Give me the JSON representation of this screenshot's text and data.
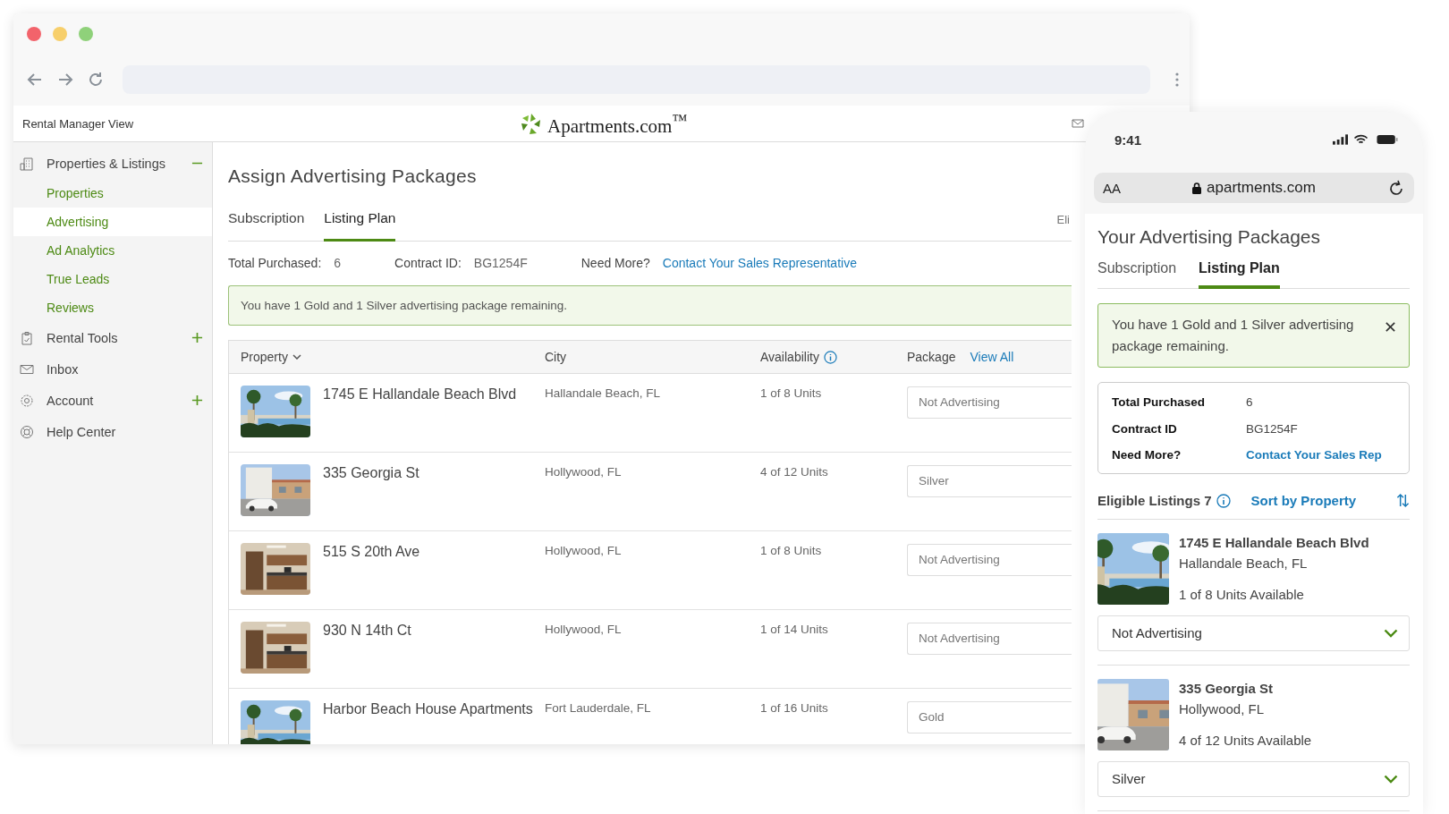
{
  "browser": {
    "header": {
      "title": "Rental Manager View",
      "logo": "Apartments.com$^{™}$"
    },
    "sidebar": {
      "items": [
        {
          "label": "Properties & Listings",
          "expanded": true,
          "children": [
            {
              "label": "Properties",
              "selected": false
            },
            {
              "label": "Advertising",
              "selected": true
            },
            {
              "label": "Ad Analytics",
              "selected": false
            },
            {
              "label": "True Leads",
              "selected": false
            },
            {
              "label": "Reviews",
              "selected": false
            }
          ]
        },
        {
          "label": "Rental Tools",
          "expanded": false
        },
        {
          "label": "Inbox"
        },
        {
          "label": "Account",
          "expanded": false
        },
        {
          "label": "Help Center"
        }
      ]
    },
    "main": {
      "title": "Assign Advertising Packages",
      "tabs": [
        {
          "label": "Subscription",
          "selected": false
        },
        {
          "label": "Listing Plan",
          "selected": true
        }
      ],
      "tabs_overflow": "Eli",
      "summary": [
        {
          "label": "Total Purchased:",
          "value": "6"
        },
        {
          "label": "Contract ID:",
          "value": "BG1254F"
        },
        {
          "label": "Need More?",
          "link": "Contact Your Sales Representative"
        }
      ],
      "alert": "You have 1 Gold and 1 Silver advertising package remaining.",
      "table": {
        "columns": [
          {
            "label": "Property",
            "kind": "sortable"
          },
          {
            "label": "City",
            "kind": "plain"
          },
          {
            "label": "Availability",
            "kind": "info"
          },
          {
            "label": "Package",
            "kind": "link",
            "link": "View All"
          }
        ],
        "rows": [
          {
            "property": "1745 E Hallandale Beach Blvd",
            "city": "Hallandale Beach, FL",
            "availability": "1 of 8 Units",
            "package": "Not Advertising"
          },
          {
            "property": "335 Georgia St",
            "city": "Hollywood, FL",
            "availability": "4 of 12 Units",
            "package": "Silver"
          },
          {
            "property": "515 S 20th Ave",
            "city": "Hollywood, FL",
            "availability": "1 of 8 Units",
            "package": "Not Advertising"
          },
          {
            "property": "930 N 14th Ct",
            "city": "Hollywood, FL",
            "availability": "1 of 14 Units",
            "package": "Not Advertising"
          },
          {
            "property": "Harbor Beach House Apartments",
            "city": "Fort Lauderdale, FL",
            "availability": "1 of 16 Units",
            "package": "Gold"
          }
        ]
      }
    }
  },
  "phone": {
    "time": "9:41",
    "text_size": "AA",
    "address": "apartments.com",
    "title": "Your Advertising Packages",
    "tabs": [
      {
        "label": "Subscription",
        "selected": false
      },
      {
        "label": "Listing Plan",
        "selected": true
      }
    ],
    "alert": "You have 1 Gold and 1 Silver advertising package remaining.",
    "info": [
      {
        "label": "Total Purchased",
        "value": "6"
      },
      {
        "label": "Contract ID",
        "value": "BG1254F"
      },
      {
        "label": "Need More?",
        "link": "Contact Your Sales Rep"
      }
    ],
    "listings_title": "Eligible Listings 7",
    "sort": "Sort by Property",
    "listings": [
      {
        "name": "1745 E Hallandale Beach Blvd",
        "city": "Hallandale Beach, FL",
        "availability": "1 of 8 Units Available",
        "package": "Not Advertising"
      },
      {
        "name": "335 Georgia St",
        "city": "Hollywood, FL",
        "availability": "4 of 12 Units Available",
        "package": "Silver"
      }
    ]
  }
}
